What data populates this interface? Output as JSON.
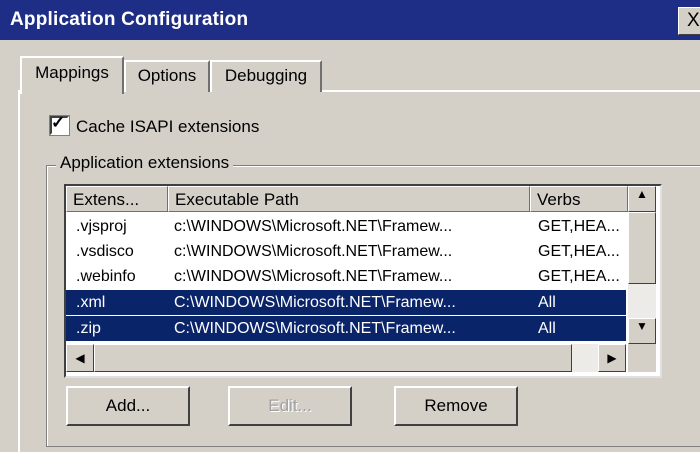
{
  "window": {
    "title": "Application Configuration",
    "close_label": "X"
  },
  "tabs": [
    {
      "label": "Mappings",
      "active": true
    },
    {
      "label": "Options",
      "active": false
    },
    {
      "label": "Debugging",
      "active": false
    }
  ],
  "cache_isapi": {
    "label": "Cache ISAPI extensions",
    "checked": true
  },
  "extensions_group": {
    "label": "Application extensions",
    "columns": [
      "Extens...",
      "Executable Path",
      "Verbs"
    ],
    "rows": [
      {
        "extension": ".vjsproj",
        "path": "c:\\WINDOWS\\Microsoft.NET\\Framew...",
        "verbs": "GET,HEA...",
        "selected": false
      },
      {
        "extension": ".vsdisco",
        "path": "c:\\WINDOWS\\Microsoft.NET\\Framew...",
        "verbs": "GET,HEA...",
        "selected": false
      },
      {
        "extension": ".webinfo",
        "path": "c:\\WINDOWS\\Microsoft.NET\\Framew...",
        "verbs": "GET,HEA...",
        "selected": false
      },
      {
        "extension": ".xml",
        "path": "C:\\WINDOWS\\Microsoft.NET\\Framew...",
        "verbs": "All",
        "selected": true
      },
      {
        "extension": ".zip",
        "path": "C:\\WINDOWS\\Microsoft.NET\\Framew...",
        "verbs": "All",
        "selected": true
      }
    ]
  },
  "buttons": {
    "add": "Add...",
    "edit": "Edit...",
    "remove": "Remove"
  },
  "colors": {
    "titlebar": "#1e2d86",
    "selection": "#0a246a",
    "dialog_face": "#d4d0c8"
  }
}
